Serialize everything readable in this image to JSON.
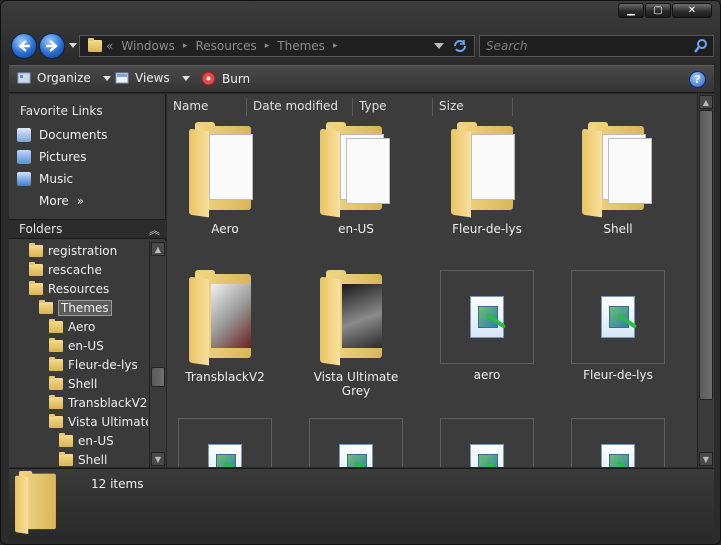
{
  "titlebar": {
    "controls": {
      "minimize": "▁",
      "maximize": "▢",
      "close": "✕"
    }
  },
  "address": {
    "overflow": "«",
    "crumbs": [
      "Windows",
      "Resources",
      "Themes"
    ],
    "separator": "▸"
  },
  "search": {
    "placeholder": "Search"
  },
  "toolbar": {
    "organize": "Organize",
    "views": "Views",
    "burn": "Burn",
    "help": "?"
  },
  "favorites": {
    "title": "Favorite Links",
    "items": [
      "Documents",
      "Pictures",
      "Music"
    ],
    "more": "More",
    "more_glyph": "»"
  },
  "folders": {
    "title": "Folders",
    "chevron": "︽",
    "tree": [
      "registration",
      "rescache",
      "Resources",
      "Themes",
      "Aero",
      "en-US",
      "Fleur-de-lys",
      "Shell",
      "TransblackV2",
      "Vista Ultimate",
      "en-US",
      "Shell"
    ],
    "selected": "Themes"
  },
  "columns": [
    "Name",
    "Date modified",
    "Type",
    "Size"
  ],
  "files": {
    "row1": [
      "Aero",
      "en-US",
      "Fleur-de-lys",
      "Shell"
    ],
    "row2": [
      "TransblackV2",
      "Vista Ultimate Grey",
      "aero",
      "Fleur-de-lys"
    ]
  },
  "details": {
    "count": "12 items"
  },
  "colors": {
    "folder": "#e8c56a",
    "accent_blue": "#2a6fd0",
    "background": "#3c3c3c"
  }
}
